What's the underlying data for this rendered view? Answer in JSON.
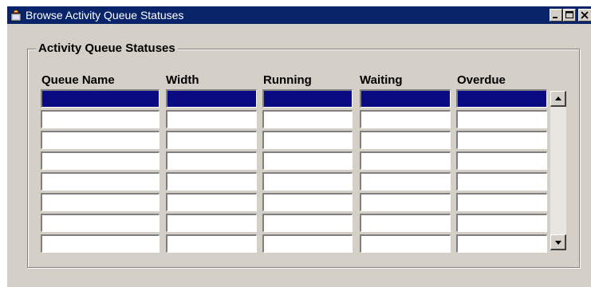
{
  "window": {
    "title": "Browse Activity Queue Statuses",
    "icons": {
      "app": "oracle-forms-icon",
      "minimize": "minimize-icon",
      "maximize": "maximize-icon",
      "close": "close-icon"
    }
  },
  "group": {
    "title": "Activity Queue Statuses"
  },
  "table": {
    "columns": [
      "Queue Name",
      "Width",
      "Running",
      "Waiting",
      "Overdue"
    ],
    "rows": [
      [
        "",
        "",
        "",
        "",
        ""
      ],
      [
        "",
        "",
        "",
        "",
        ""
      ],
      [
        "",
        "",
        "",
        "",
        ""
      ],
      [
        "",
        "",
        "",
        "",
        ""
      ],
      [
        "",
        "",
        "",
        "",
        ""
      ],
      [
        "",
        "",
        "",
        "",
        ""
      ],
      [
        "",
        "",
        "",
        "",
        ""
      ],
      [
        "",
        "",
        "",
        "",
        ""
      ]
    ],
    "selected_row": 0
  },
  "scrollbar": {
    "up_icon": "scroll-up-arrow-icon",
    "down_icon": "scroll-down-arrow-icon"
  },
  "colors": {
    "titlebar": "#0a246a",
    "selection": "#0a0a82",
    "face": "#d4d0c8"
  }
}
